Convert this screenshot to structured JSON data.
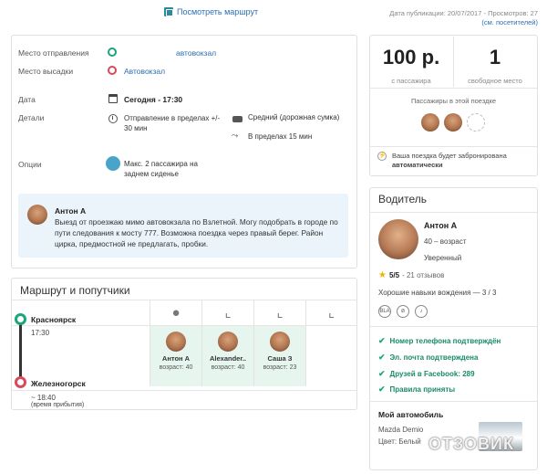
{
  "top": {
    "route_link": "Посмотреть маршрут",
    "pub_info": "Дата публикации: 20/07/2017 - Просмотров: 27",
    "visitors_link": "(см. посетителей)"
  },
  "details": {
    "departure_label": "Место отправления",
    "departure_value": "автовокзал",
    "dropoff_label": "Место высадки",
    "dropoff_value": "Автовокзал",
    "date_label": "Дата",
    "date_value": "Сегодня - 17:30",
    "details_label": "Детали",
    "detail_departure": "Отправление в пределах +/- 30 мин",
    "detail_luggage": "Средний (дорожная сумка)",
    "detail_detour": "В пределах 15 мин",
    "options_label": "Опции",
    "options_value": "Макс. 2 пассажира на заднем сиденье"
  },
  "note": {
    "author": "Антон А",
    "text": "Выезд от                          проезжаю мимо автовокзала по Взлетной. Могу подобрать в городе по пути следования к мосту 777. Возможна поездка через правый берег. Район цирка, предмостной не предлагать, пробки."
  },
  "route": {
    "title": "Маршрут и попутчики",
    "from_city": "Красноярск",
    "from_time": "17:30",
    "to_city": "Железногорск",
    "to_time": "~ 18:40",
    "to_note": "(время прибытия)",
    "passengers": [
      {
        "name": "Антон А",
        "age": "возраст: 40"
      },
      {
        "name": "Alexander..",
        "age": "возраст: 40"
      },
      {
        "name": "Саша З",
        "age": "возраст: 23"
      }
    ]
  },
  "pricing": {
    "price": "100 р.",
    "price_sub": "с пассажира",
    "seats": "1",
    "seats_sub": "свободное место",
    "passengers_title": "Пассажиры в этой поездке",
    "booking_note_1": "Ваша поездка будет забронирована",
    "booking_note_2": "автоматически"
  },
  "driver": {
    "title": "Водитель",
    "name": "Антон А",
    "age": "40 – возраст",
    "level": "Уверенный",
    "rating": "5/5",
    "reviews": "- 21 отзывов",
    "skills": "Хорошие навыки вождения — 3 / 3",
    "checks": [
      "Номер телефона подтверждён",
      "Эл. почта подтверждена",
      "Друзей в Facebook: 289",
      "Правила приняты"
    ],
    "car_title": "Мой автомобиль",
    "car_model": "Mazda Demio",
    "car_color": "Цвет: Белый"
  },
  "watermark": "ОТЗОВИК",
  "colors": {
    "accent_green": "#1aa57b",
    "accent_red": "#d64a5a",
    "link_blue": "#2a6fb5",
    "note_bg": "#eaf4fa"
  }
}
